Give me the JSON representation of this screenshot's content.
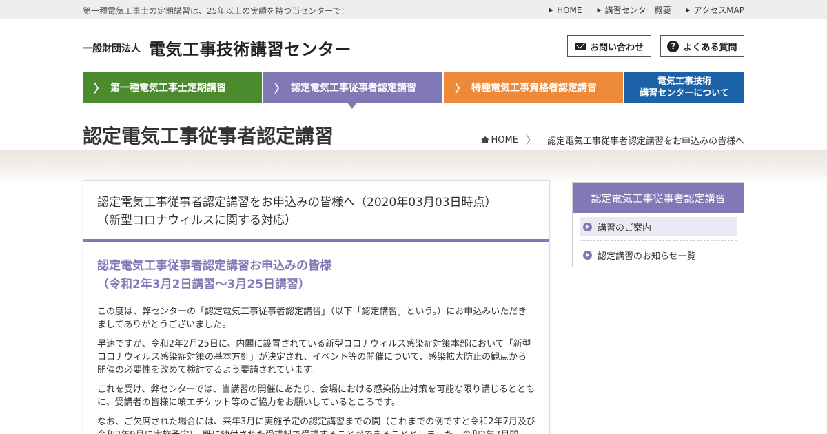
{
  "topbar": {
    "tagline": "第一種電気工事士の定期講習は、25年以上の実績を持つ当センターで！",
    "links": [
      "HOME",
      "講習センター概要",
      "アクセスMAP"
    ]
  },
  "header": {
    "org_prefix": "一般財団法人",
    "org_name": "電気工事技術講習センター",
    "contact_label": "お問い合わせ",
    "faq_label": "よくある質問"
  },
  "nav": {
    "items": [
      {
        "label": "第一種電気工事士定期講習",
        "color": "#4c8a2e"
      },
      {
        "label": "認定電気工事従事者認定講習",
        "color": "#8079b5"
      },
      {
        "label": "特種電気工事資格者認定講習",
        "color": "#ec8a3a"
      },
      {
        "label_line1": "電気工事技術",
        "label_line2": "講習センターについて",
        "color": "#1b62a8"
      }
    ]
  },
  "page": {
    "title": "認定電気工事従事者認定講習",
    "breadcrumb_home": "HOME",
    "breadcrumb_current": "認定電気工事従事者認定講習をお申込みの皆様へ"
  },
  "article": {
    "title_line1": "認定電気工事従事者認定講習をお申込みの皆様へ（2020年03月03日時点）",
    "title_line2": "（新型コロナウィルスに関する対応）",
    "subhead_line1": "認定電気工事従事者認定講習お申込みの皆様",
    "subhead_line2": "（令和2年3月2日講習～3月25日講習）",
    "paragraphs": [
      "この度は、弊センターの「認定電気工事従事者認定講習」（以下「認定講習」という。）にお申込みいただきましてありがとうございました。",
      "早速ですが、令和2年2月25日に、内閣に設置されている新型コロナウィルス感染症対策本部において「新型コロナウィルス感染症対策の基本方針」が決定され、イベント等の開催について、感染拡大防止の観点から開催の必要性を改めて検討するよう要請されています。",
      "これを受け、弊センターでは、当講習の開催にあたり、会場における感染防止対策を可能な限り講じるとともに、受講者の皆様に咳エチケット等のご協力をお願いしているところです。",
      "なお、ご欠席された場合には、来年3月に実施予定の認定講習までの間（これまでの例ですと令和2年7月及び令和2年9月に実施予定）、既に納付された受講料で受講することができることとしました。令和2年7月開"
    ]
  },
  "sidebar": {
    "title": "認定電気工事従事者認定講習",
    "items": [
      "講習のご案内",
      "認定講習のお知らせ一覧"
    ]
  }
}
